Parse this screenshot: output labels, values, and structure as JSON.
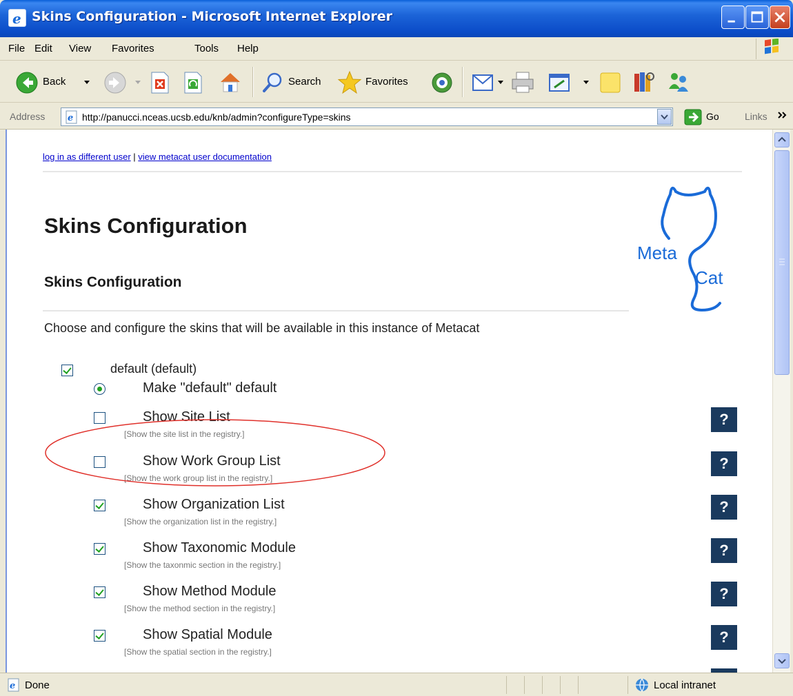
{
  "window": {
    "title": "Skins Configuration - Microsoft Internet Explorer",
    "min_icon": "minimize-icon",
    "max_icon": "maximize-icon",
    "close_icon": "close-icon"
  },
  "menu": [
    "File",
    "Edit",
    "View",
    "Favorites",
    "Tools",
    "Help"
  ],
  "toolbar": {
    "back": "Back",
    "search": "Search",
    "favorites": "Favorites"
  },
  "address": {
    "label": "Address",
    "url": "http://panucci.nceas.ucsb.edu/knb/admin?configureType=skins",
    "go": "Go",
    "links": "Links"
  },
  "page": {
    "link_login": "log in as different user",
    "link_sep": " | ",
    "link_docs": "view metacat user documentation",
    "title": "Skins Configuration",
    "subtitle": "Skins Configuration",
    "intro": "Choose and configure the skins that will be available in this instance of Metacat",
    "logo_text_1": "Meta",
    "logo_text_2": "Cat",
    "skin": {
      "label": "default (default)",
      "checked": true,
      "make_default_label": "Make \"default\" default",
      "make_default_selected": true
    },
    "help_glyph": "?",
    "options": [
      {
        "label": "Show Site List",
        "desc": "[Show the site list in the registry.]",
        "checked": false
      },
      {
        "label": "Show Work Group List",
        "desc": "[Show the work group list in the registry.]",
        "checked": false
      },
      {
        "label": "Show Organization List",
        "desc": "[Show the organization list in the registry.]",
        "checked": true
      },
      {
        "label": "Show Taxonomic Module",
        "desc": "[Show the taxonmic section in the registry.]",
        "checked": true
      },
      {
        "label": "Show Method Module",
        "desc": "[Show the method section in the registry.]",
        "checked": true
      },
      {
        "label": "Show Spatial Module",
        "desc": "[Show the spatial section in the registry.]",
        "checked": true
      }
    ]
  },
  "status": {
    "text": "Done",
    "zone": "Local intranet"
  },
  "colors": {
    "titlebar": "#0b4cc8",
    "link": "#0000cc",
    "help_button": "#1a3a5e",
    "highlight_ellipse": "#e0302a",
    "checkmark": "#21a121"
  }
}
